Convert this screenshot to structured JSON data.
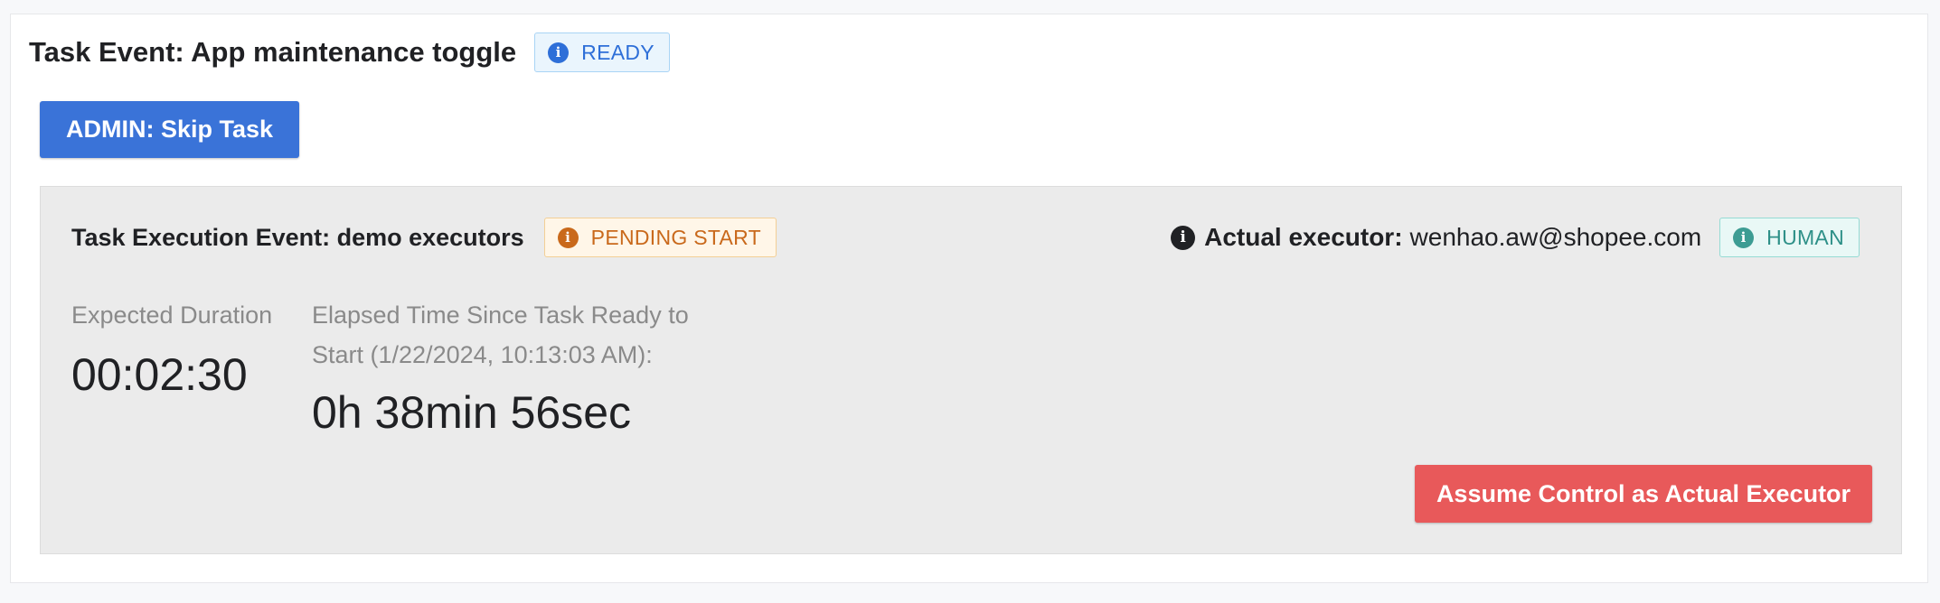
{
  "task": {
    "title": "Task Event: App maintenance toggle",
    "status_icon": "info-icon",
    "status_badge": "READY",
    "skip_button": "ADMIN: Skip Task"
  },
  "execution": {
    "title": "Task Execution Event: demo executors",
    "status_icon": "info-icon",
    "status_badge": "PENDING START",
    "executor_label": "Actual executor:",
    "executor_value": "wenhao.aw@shopee.com",
    "executor_type_badge": "HUMAN",
    "expected_duration_label": "Expected Duration",
    "expected_duration_value": "00:02:30",
    "elapsed_label": "Elapsed Time Since Task Ready to Start (1/22/2024, 10:13:03 AM):",
    "elapsed_value": "0h 38min 56sec",
    "assume_button": "Assume Control as Actual Executor"
  },
  "colors": {
    "primary": "#3a73d8",
    "danger": "#e8595a",
    "ready": "#2e6fd8",
    "pending": "#c9691b",
    "human": "#2e9088"
  }
}
